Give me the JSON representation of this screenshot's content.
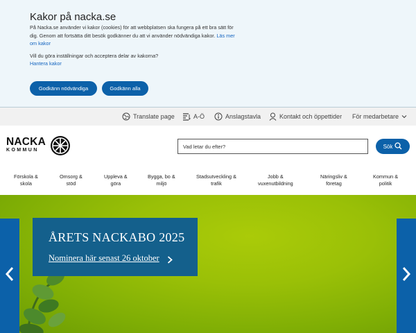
{
  "cookie": {
    "title": "Kakor på nacka.se",
    "body": "På Nacka.se använder vi kakor (cookies) för att webbplatsen ska fungera på ett bra sätt för dig. Genom att fortsätta ditt besök godkänner du att vi använder nödvändiga kakor.",
    "read_more": "Läs mer om kakor",
    "question": "Vill du göra inställningar och acceptera delar av kakorna?",
    "manage": "Hantera kakor",
    "accept_necessary": "Godkänn nödvändiga",
    "accept_all": "Godkänn alla"
  },
  "utility": {
    "translate": "Translate page",
    "a_o": "A-Ö",
    "anslagstavla": "Anslagstavla",
    "kontakt": "Kontakt och öppettider",
    "medarbetare": "För medarbetare"
  },
  "logo": {
    "line1": "NACKA",
    "line2": "KOMMUN"
  },
  "search": {
    "placeholder": "Vad letar du efter?",
    "button": "Sök"
  },
  "nav": {
    "items": [
      {
        "label": "Förskola &\nskola"
      },
      {
        "label": "Omsorg &\nstöd"
      },
      {
        "label": "Uppleva &\ngöra"
      },
      {
        "label": "Bygga, bo &\nmiljö"
      },
      {
        "label": "Stadsutveckling &\ntrafik"
      },
      {
        "label": "Jobb &\nvuxenutbildning"
      },
      {
        "label": "Näringsliv &\nföretag"
      },
      {
        "label": "Kommun &\npolitik"
      }
    ]
  },
  "hero": {
    "title": "ÅRETS NACKABO 2025",
    "link": "Nominera här senast 26 oktober"
  },
  "colors": {
    "primary": "#0c61a9",
    "hero_card": "#14608c",
    "hero_green": "#9ac007",
    "cookie_bg": "#eef6fa"
  }
}
